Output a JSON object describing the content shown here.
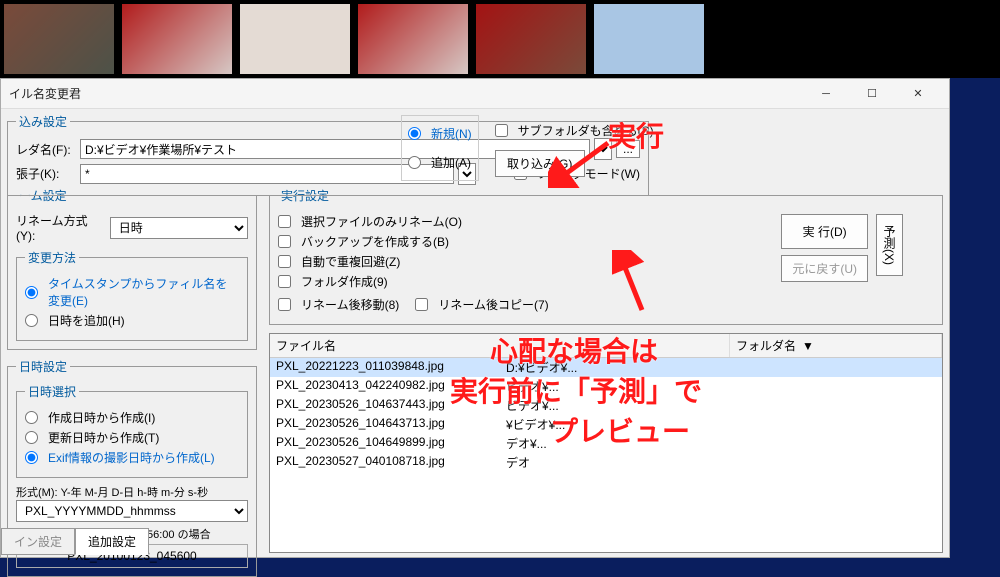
{
  "window": {
    "title": "イル名変更君"
  },
  "folder": {
    "legend": "込み設定",
    "name_label": "レダ名(F):",
    "path": "D:¥ビデオ¥作業場所¥テスト",
    "ext_label": "張子(K):",
    "ext": "*",
    "folder_mode": "フォルダモード(W)",
    "browse": "...",
    "new_radio": "新規(N)",
    "add_radio": "追加(A)",
    "include_sub": "サブフォルダも含める(S)",
    "load_btn": "取り込み(G)"
  },
  "rename": {
    "legend": "ーム設定",
    "method_label": "リネーム方式(Y):",
    "method": "日時",
    "change_legend": "変更方法",
    "from_ts": "タイムスタンプからファィル名を変更(E)",
    "add_time": "日時を追加(H)",
    "date_legend": "日時設定",
    "date_sel_legend": "日時選択",
    "from_create": "作成日時から作成(I)",
    "from_update": "更新日時から作成(T)",
    "from_exif": "Exif情報の撮影日時から作成(L)",
    "format_label": "形式(M): Y-年 M-月 D-日 h-時 m-分 s-秒",
    "format": "PXL_YYYYMMDD_hhmmss",
    "example_label": "例: 2010/01/23, 04:56:00 の場合",
    "example": "PXL_20100123_045600"
  },
  "exec": {
    "legend": "実行設定",
    "only_selected": "選択ファイルのみリネーム(O)",
    "backup": "バックアップを作成する(B)",
    "auto_dup": "自動で重複回避(Z)",
    "mkdir": "フォルダ作成(9)",
    "move_after": "リネーム後移動(8)",
    "copy_after": "リネーム後コピー(7)",
    "run_btn": "実 行(D)",
    "undo_btn": "元に戻す(U)",
    "predict_btn": "予測(X)"
  },
  "list": {
    "col_file": "ファイル名",
    "col_folder": "フォルダ名",
    "rows": [
      {
        "file": "PXL_20221223_011039848.jpg",
        "folder": "D:¥ビデオ¥..."
      },
      {
        "file": "PXL_20230413_042240982.jpg",
        "folder": "ビデオ¥..."
      },
      {
        "file": "PXL_20230526_104637443.jpg",
        "folder": "ビデオ¥..."
      },
      {
        "file": "PXL_20230526_104643713.jpg",
        "folder": "¥ビデオ¥..."
      },
      {
        "file": "PXL_20230526_104649899.jpg",
        "folder": "デオ¥..."
      },
      {
        "file": "PXL_20230527_040108718.jpg",
        "folder": "デオ"
      }
    ]
  },
  "tabs": {
    "main": "イン設定",
    "extra": "追加設定"
  },
  "annot": {
    "run": "実行",
    "note1": "心配な場合は",
    "note2": "実行前に「予測」で",
    "note3": "プレビュー"
  }
}
